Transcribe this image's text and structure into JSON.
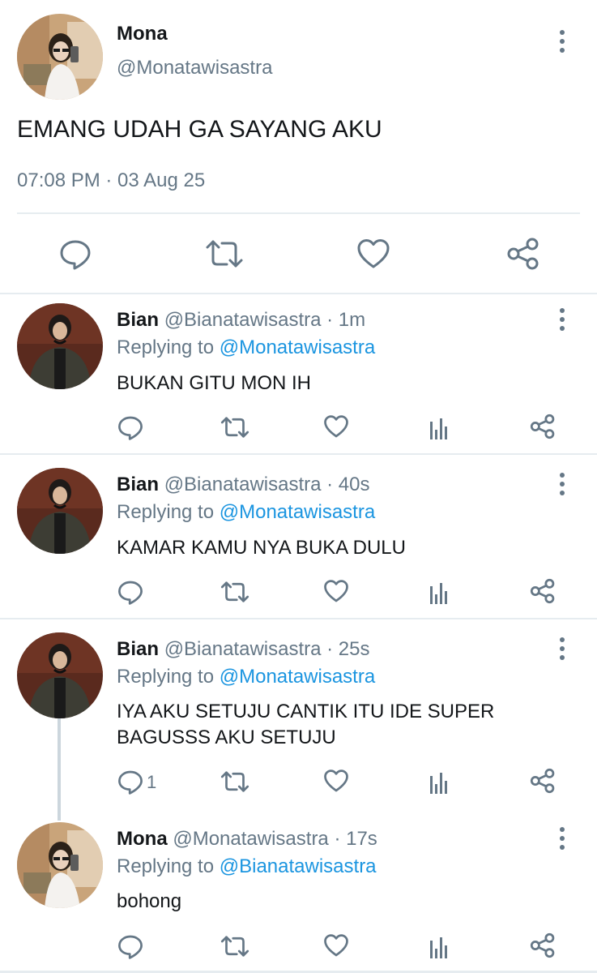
{
  "main_tweet": {
    "display_name": "Mona",
    "handle": "@Monatawisastra",
    "text": "EMANG UDAH GA SAYANG AKU",
    "timestamp": "07:08 PM · 03 Aug 25",
    "actions": [
      "reply-icon",
      "retweet-icon",
      "like-icon",
      "share-icon"
    ]
  },
  "replies": [
    {
      "display_name": "Bian",
      "handle": "@Bianatawisastra",
      "age": "· 1m",
      "replying_prefix": "Replying to",
      "replying_to": "@Monatawisastra",
      "text": "BUKAN GITU MON IH",
      "reply_count": ""
    },
    {
      "display_name": "Bian",
      "handle": "@Bianatawisastra",
      "age": "· 40s",
      "replying_prefix": "Replying to",
      "replying_to": "@Monatawisastra",
      "text": "KAMAR KAMU NYA BUKA DULU",
      "reply_count": ""
    },
    {
      "display_name": "Bian",
      "handle": "@Bianatawisastra",
      "age": "· 25s",
      "replying_prefix": "Replying to",
      "replying_to": "@Monatawisastra",
      "text_lines": [
        "IYA AKU SETUJU CANTIK ITU IDE SUPER",
        "BAGUSSS AKU SETUJU"
      ],
      "reply_count": "1"
    },
    {
      "display_name": "Mona",
      "handle": "@Monatawisastra",
      "age": "· 17s",
      "replying_prefix": "Replying to",
      "replying_to": "@Bianatawisastra",
      "text": "bohong",
      "reply_count": ""
    }
  ],
  "colors": {
    "text": "#14171a",
    "secondary": "#657786",
    "link": "#1b95e0",
    "divider": "#e6ecf0"
  }
}
